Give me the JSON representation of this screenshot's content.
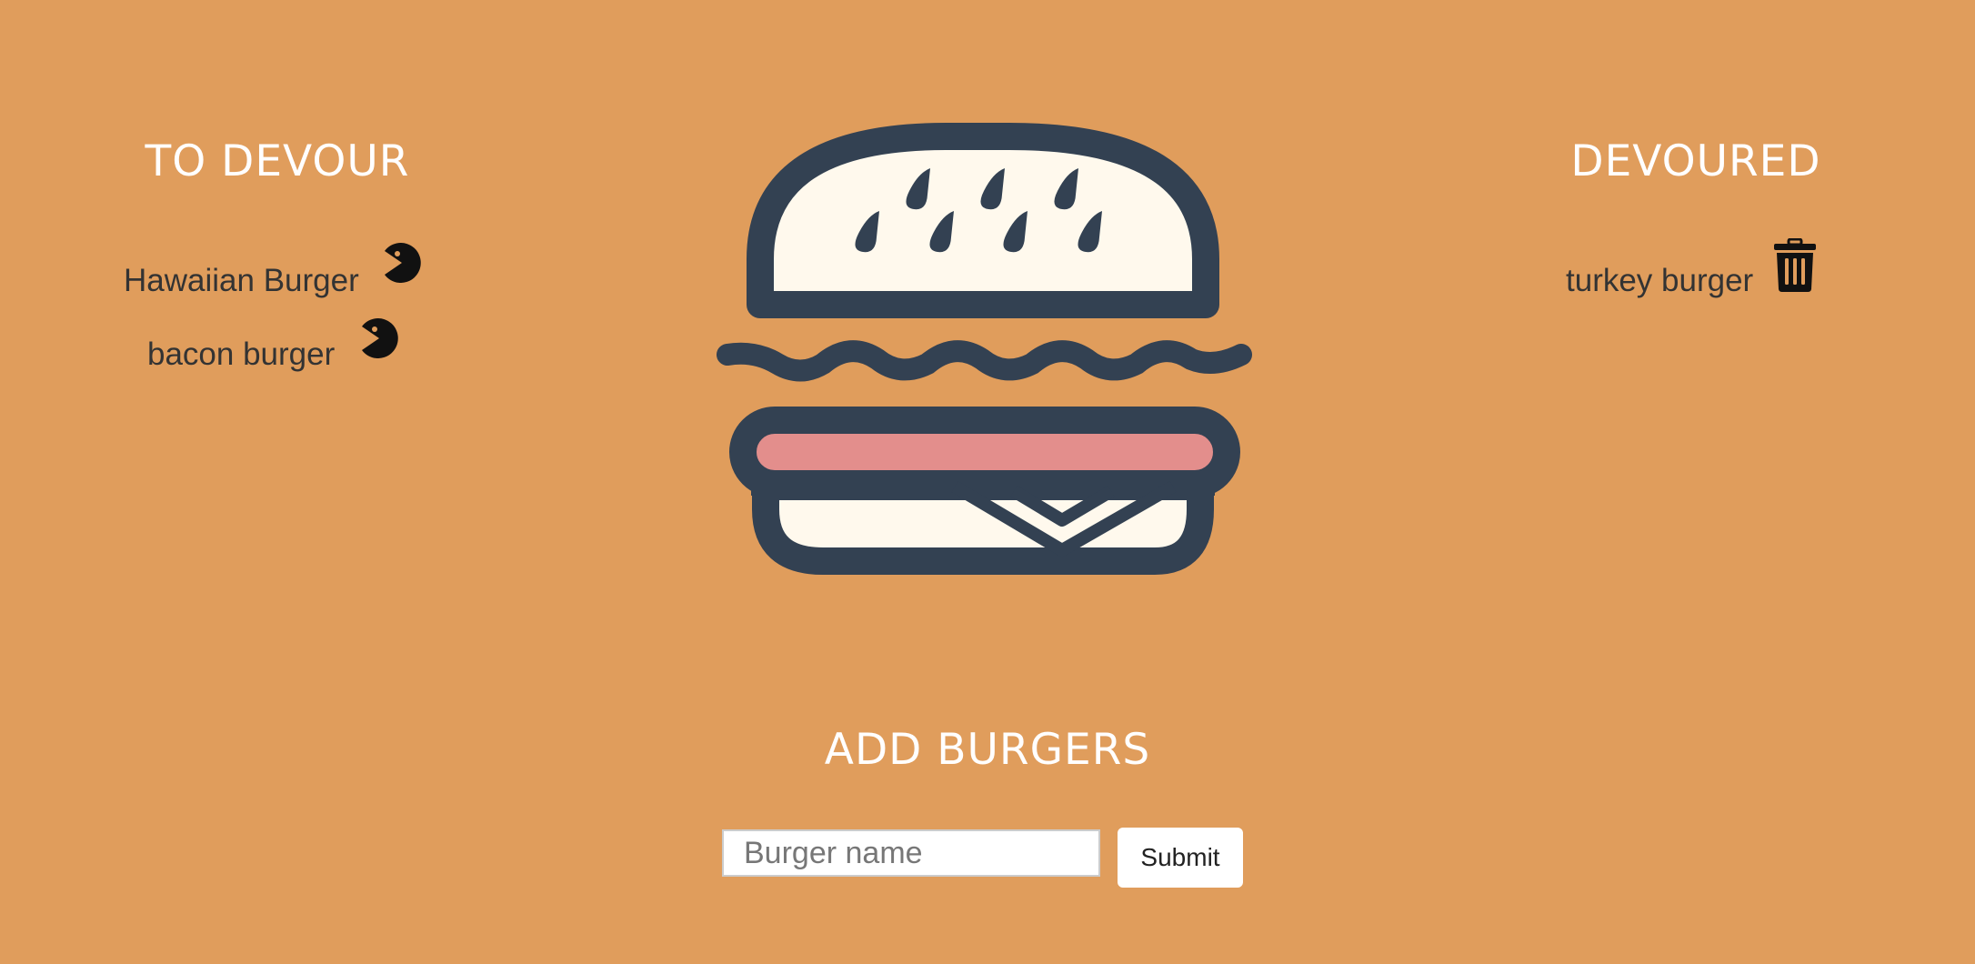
{
  "colors": {
    "background": "#E09D5C",
    "heading": "#ffffff",
    "text": "#333333",
    "burger_outline": "#334152",
    "burger_bun": "#FFF9ED",
    "burger_patty": "#E38E8C"
  },
  "to_devour": {
    "title": "TO DEVOUR",
    "action_icon": "pacman-icon",
    "items": [
      {
        "name": "Hawaiian Burger"
      },
      {
        "name": "bacon burger"
      }
    ]
  },
  "devoured": {
    "title": "DEVOURED",
    "action_icon": "trash-icon",
    "items": [
      {
        "name": "turkey burger"
      }
    ]
  },
  "hero": {
    "icon": "burger-icon"
  },
  "add_burgers": {
    "title": "ADD BURGERS",
    "input_placeholder": "Burger name",
    "input_value": "",
    "submit_label": "Submit"
  }
}
